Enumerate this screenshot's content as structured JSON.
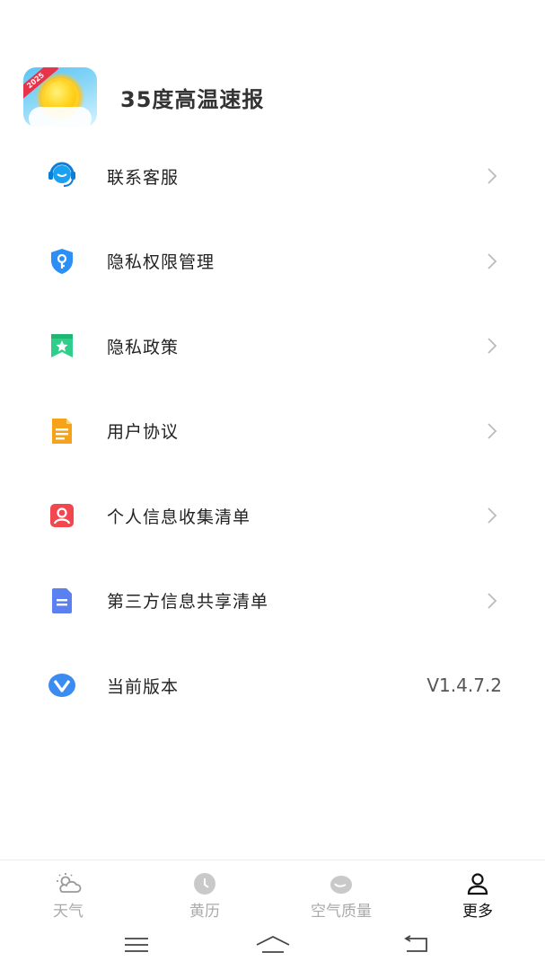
{
  "app": {
    "title": "35度高温速报",
    "logo_badge": "2025"
  },
  "menu": [
    {
      "label": "联系客服",
      "icon": "headset-icon",
      "icon_color": "#1aa0f0",
      "chevron": true
    },
    {
      "label": "隐私权限管理",
      "icon": "shield-key-icon",
      "icon_color": "#2b8ff5",
      "chevron": true
    },
    {
      "label": "隐私政策",
      "icon": "bookmark-star-icon",
      "icon_color": "#2ecf8a",
      "chevron": true
    },
    {
      "label": "用户协议",
      "icon": "document-icon",
      "icon_color": "#f7a21b",
      "chevron": true
    },
    {
      "label": "个人信息收集清单",
      "icon": "person-card-icon",
      "icon_color": "#f2474f",
      "chevron": true
    },
    {
      "label": "第三方信息共享清单",
      "icon": "file-list-icon",
      "icon_color": "#5b80f0",
      "chevron": true
    },
    {
      "label": "当前版本",
      "icon": "version-v-icon",
      "icon_color": "#3b8cf0",
      "chevron": false,
      "value": "V1.4.7.2"
    }
  ],
  "bottom_nav": [
    {
      "label": "天气",
      "icon": "weather-icon",
      "active": false
    },
    {
      "label": "黄历",
      "icon": "calendar-clock-icon",
      "active": false
    },
    {
      "label": "空气质量",
      "icon": "air-quality-icon",
      "active": false
    },
    {
      "label": "更多",
      "icon": "profile-icon",
      "active": true
    }
  ],
  "system_nav": [
    "menu-icon",
    "home-icon",
    "back-icon"
  ],
  "colors": {
    "text_primary": "#222222",
    "text_inactive": "#aaaaaa",
    "chevron": "#bbbbbb"
  }
}
